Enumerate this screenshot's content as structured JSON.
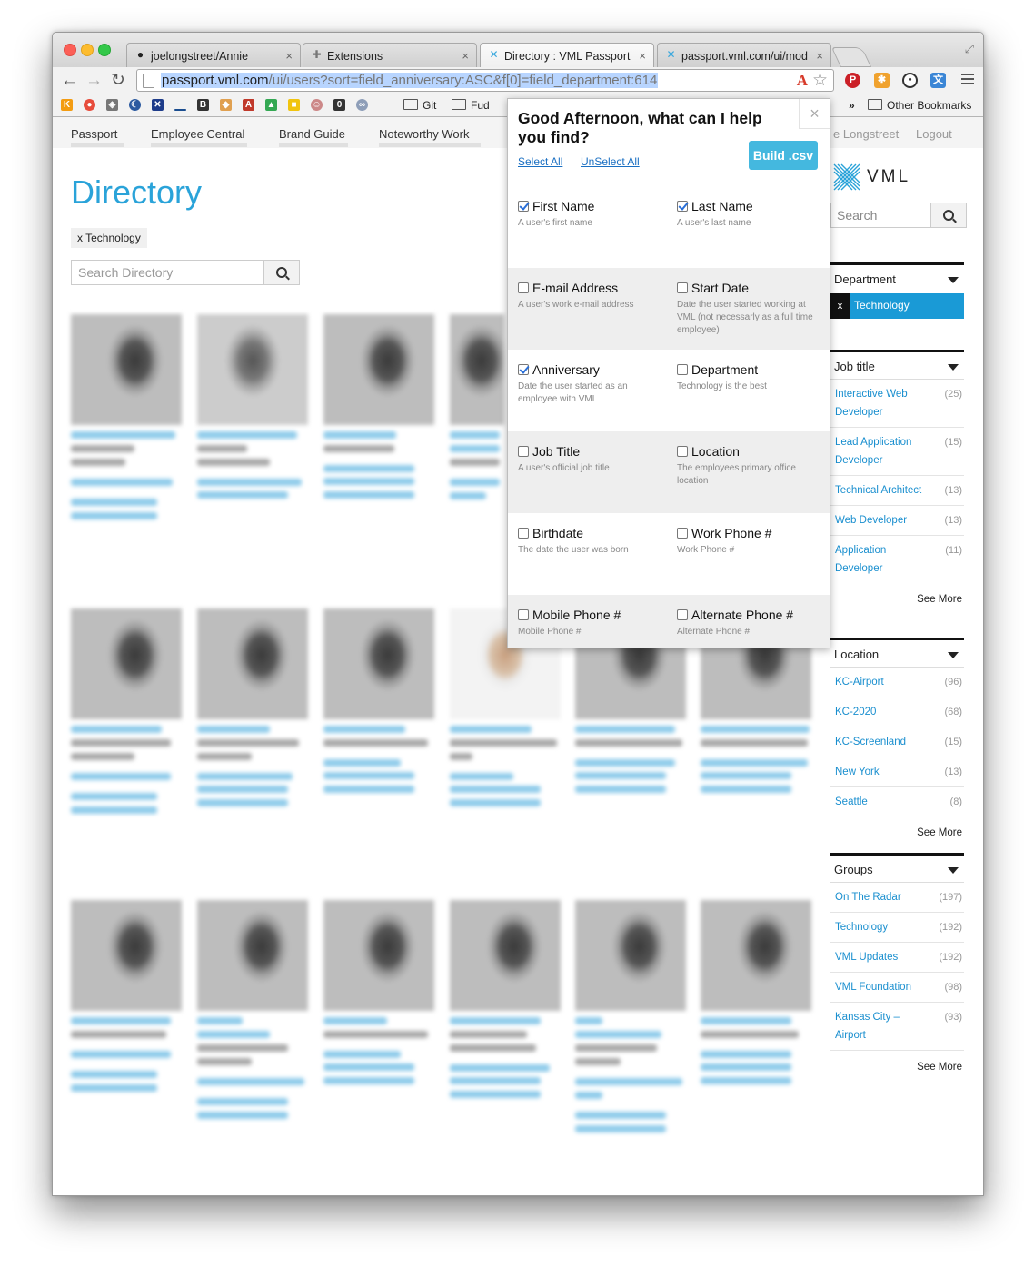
{
  "browser": {
    "tabs": [
      {
        "label": "joelongstreet/Annie",
        "icon": "github-icon"
      },
      {
        "label": "Extensions",
        "icon": "puzzle-icon"
      },
      {
        "label": "Directory : VML Passport",
        "icon": "vml-icon",
        "active": true
      },
      {
        "label": "passport.vml.com/ui/mod",
        "icon": "vml-icon"
      }
    ],
    "url_host": "passport.vml.com",
    "url_path": "/ui/users?sort=field_anniversary:ASC&f[0]=field_department:614",
    "bookmarks": [
      {
        "label": "Git"
      },
      {
        "label": "Fud"
      }
    ],
    "overflow_label": "»",
    "other_bookmarks": "Other Bookmarks"
  },
  "site_nav": {
    "items": [
      "Passport",
      "Employee Central",
      "Brand Guide",
      "Noteworthy Work"
    ],
    "user_name_partial": "e Longstreet",
    "logout": "Logout"
  },
  "directory": {
    "title": "Directory",
    "filter_chip": "x Technology",
    "search_placeholder": "Search Directory"
  },
  "sidebar": {
    "logo_text": "VML",
    "search_placeholder": "Search",
    "department": {
      "title": "Department",
      "selected": "Technology",
      "remove": "x"
    },
    "job_title": {
      "title": "Job title",
      "items": [
        {
          "label": "Interactive Web Developer",
          "count": "(25)"
        },
        {
          "label": "Lead Application Developer",
          "count": "(15)"
        },
        {
          "label": "Technical Architect",
          "count": "(13)"
        },
        {
          "label": "Web Developer",
          "count": "(13)"
        },
        {
          "label": "Application Developer",
          "count": "(11)"
        }
      ],
      "see_more": "See More"
    },
    "location": {
      "title": "Location",
      "items": [
        {
          "label": "KC-Airport",
          "count": "(96)"
        },
        {
          "label": "KC-2020",
          "count": "(68)"
        },
        {
          "label": "KC-Screenland",
          "count": "(15)"
        },
        {
          "label": "New York",
          "count": "(13)"
        },
        {
          "label": "Seattle",
          "count": "(8)"
        }
      ],
      "see_more": "See More"
    },
    "groups": {
      "title": "Groups",
      "items": [
        {
          "label": "On The Radar",
          "count": "(197)"
        },
        {
          "label": "Technology",
          "count": "(192)"
        },
        {
          "label": "VML Updates",
          "count": "(192)"
        },
        {
          "label": "VML Foundation",
          "count": "(98)"
        },
        {
          "label": "Kansas City – Airport",
          "count": "(93)"
        }
      ],
      "see_more": "See More"
    }
  },
  "popup": {
    "title": "Good Afternoon, what can I help you find?",
    "close": "×",
    "select_all": "Select All",
    "unselect_all": "UnSelect All",
    "build_csv": "Build .csv",
    "rows": [
      [
        {
          "label": "First Name",
          "desc": "A user's first name",
          "checked": true
        },
        {
          "label": "Last Name",
          "desc": "A user's last name",
          "checked": true
        }
      ],
      [
        {
          "label": "E-mail Address",
          "desc": "A user's work e-mail address",
          "checked": false
        },
        {
          "label": "Start Date",
          "desc": "Date the user started working at VML (not necessarly as a full time employee)",
          "checked": false
        }
      ],
      [
        {
          "label": "Anniversary",
          "desc": "Date the user started as an employee with VML",
          "checked": true
        },
        {
          "label": "Department",
          "desc": "Technology is the best",
          "checked": false
        }
      ],
      [
        {
          "label": "Job Title",
          "desc": "A user's official job title",
          "checked": false
        },
        {
          "label": "Location",
          "desc": "The employees primary office location",
          "checked": false
        }
      ],
      [
        {
          "label": "Birthdate",
          "desc": "The date the user was born",
          "checked": false
        },
        {
          "label": "Work Phone #",
          "desc": "Work Phone #",
          "checked": false
        }
      ],
      [
        {
          "label": "Mobile Phone #",
          "desc": "Mobile Phone #",
          "checked": false
        },
        {
          "label": "Alternate Phone #",
          "desc": "Alternate Phone #",
          "checked": false
        }
      ]
    ]
  }
}
